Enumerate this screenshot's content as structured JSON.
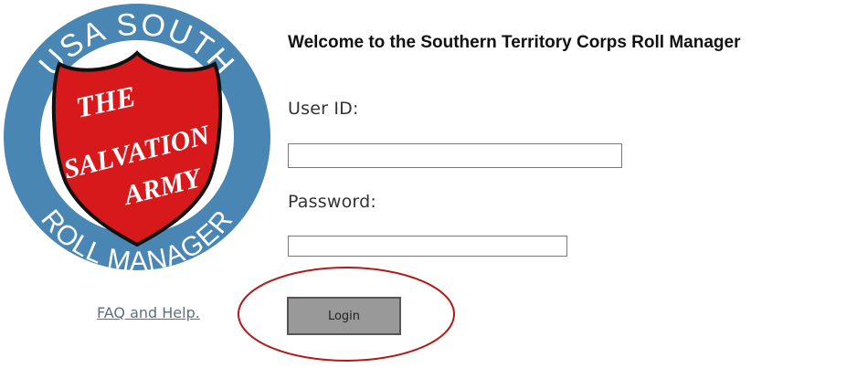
{
  "logo": {
    "top_arc_text": "USA SOUTH",
    "bottom_arc_text": "ROLL MANAGER",
    "shield_line1": "THE",
    "shield_line2": "SALVATION",
    "shield_line3": "ARMY",
    "ring_color": "#4a86b4",
    "shield_color": "#d7191c"
  },
  "header": {
    "welcome_text": "Welcome to the Southern Territory Corps Roll Manager"
  },
  "form": {
    "user_id_label": "User ID:",
    "user_id_value": "",
    "password_label": "Password:",
    "password_value": "",
    "login_label": "Login"
  },
  "links": {
    "faq_text": "FAQ and Help."
  },
  "annotation": {
    "highlight_color": "#b01a1a"
  }
}
